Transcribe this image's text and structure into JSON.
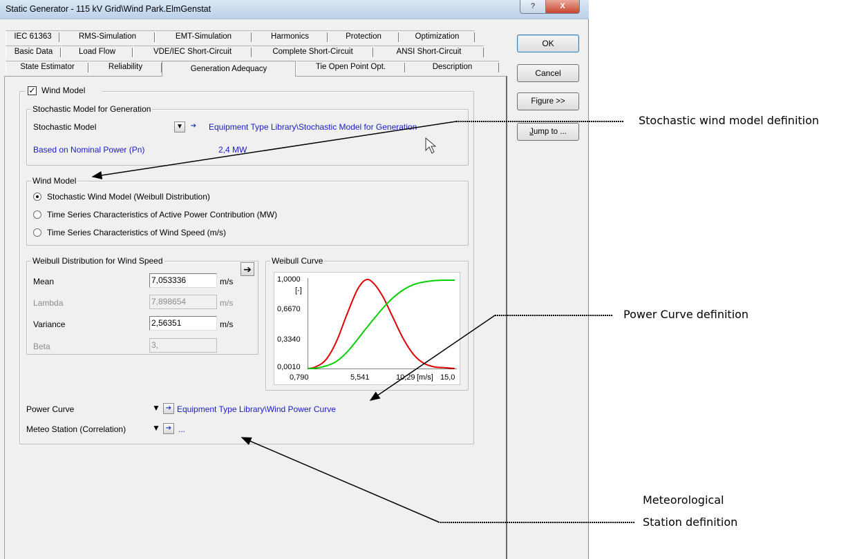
{
  "window": {
    "title": "Static Generator - 115 kV Grid\\Wind Park.ElmGenstat",
    "help_glyph": "?",
    "close_glyph": "X"
  },
  "tabs": {
    "row1": [
      "IEC 61363",
      "RMS-Simulation",
      "EMT-Simulation",
      "Harmonics",
      "Protection",
      "Optimization"
    ],
    "row2": [
      "Basic Data",
      "Load Flow",
      "VDE/IEC Short-Circuit",
      "Complete Short-Circuit",
      "ANSI Short-Circuit"
    ],
    "row3": [
      "State Estimator",
      "Reliability",
      "Generation Adequacy",
      "Tie Open Point Opt.",
      "Description"
    ],
    "active": "Generation Adequacy"
  },
  "buttons": {
    "ok": "OK",
    "cancel": "Cancel",
    "figure": "Figure >>",
    "jump_prefix": "J",
    "jump_rest": "ump to ..."
  },
  "wind_model_group": {
    "checkbox_label": "Wind Model",
    "checked": true
  },
  "stochastic_group": {
    "title": "Stochastic Model for Generation",
    "model_label": "Stochastic Model",
    "model_link": "Equipment Type Library\\Stochastic Model for Generation",
    "pn_label": "Based on Nominal Power (Pn)",
    "pn_value": "2,4 MW"
  },
  "wind_model_options": {
    "title": "Wind Model",
    "options": [
      {
        "label": "Stochastic Wind Model (Weibull Distribution)",
        "selected": true
      },
      {
        "label": "Time Series Characteristics of Active Power Contribution (MW)",
        "selected": false
      },
      {
        "label": "Time Series Characteristics of Wind Speed (m/s)",
        "selected": false
      }
    ]
  },
  "weibull_params": {
    "title": "Weibull Distribution for Wind Speed",
    "mean_label": "Mean",
    "mean_value": "7,053336",
    "mean_unit": "m/s",
    "lambda_label": "Lambda",
    "lambda_value": "7,898654",
    "lambda_unit": "m/s",
    "variance_label": "Variance",
    "variance_value": "2,56351",
    "variance_unit": "m/s",
    "beta_label": "Beta",
    "beta_value": "3,"
  },
  "weibull_curve": {
    "title": "Weibull Curve",
    "y_ticks": [
      "1,0000",
      "[-]",
      "0,6670",
      "0,3340",
      "0,0010"
    ],
    "x_ticks": [
      "0,790",
      "5,541",
      "10,29",
      "[m/s]",
      "15,0"
    ]
  },
  "chart_data": {
    "type": "line",
    "title": "Weibull Curve",
    "xlabel": "[m/s]",
    "ylabel": "[-]",
    "xlim": [
      0.79,
      15.0
    ],
    "ylim": [
      0.001,
      1.0
    ],
    "grid": false,
    "series": [
      {
        "color": "#e00000",
        "x": [
          0.79,
          1.5,
          2.5,
          3.5,
          4.5,
          5.5,
          6.3,
          7.0,
          8.0,
          9.0,
          10.0,
          11.0,
          12.0,
          13.0,
          14.0,
          15.0
        ],
        "y": [
          0.001,
          0.02,
          0.1,
          0.3,
          0.6,
          0.88,
          1.0,
          0.98,
          0.82,
          0.58,
          0.34,
          0.16,
          0.06,
          0.02,
          0.01,
          0.001
        ]
      },
      {
        "color": "#00d000",
        "x": [
          0.79,
          1.5,
          2.5,
          3.5,
          4.5,
          5.5,
          6.3,
          7.0,
          8.0,
          9.0,
          10.0,
          11.0,
          12.0,
          13.0,
          14.0,
          15.0
        ],
        "y": [
          0.001,
          0.005,
          0.03,
          0.08,
          0.18,
          0.32,
          0.44,
          0.54,
          0.68,
          0.8,
          0.89,
          0.95,
          0.98,
          0.995,
          1.0,
          1.0
        ]
      }
    ]
  },
  "bottom": {
    "power_curve_label": "Power Curve",
    "power_curve_link": "Equipment Type Library\\Wind Power Curve",
    "meteo_label": "Meteo Station (Correlation)",
    "meteo_link": "..."
  },
  "annotations": {
    "stochastic": "Stochastic wind model definition",
    "power_curve": "Power Curve definition",
    "meteo_line1": "Meteorological",
    "meteo_line2": "Station definition"
  }
}
